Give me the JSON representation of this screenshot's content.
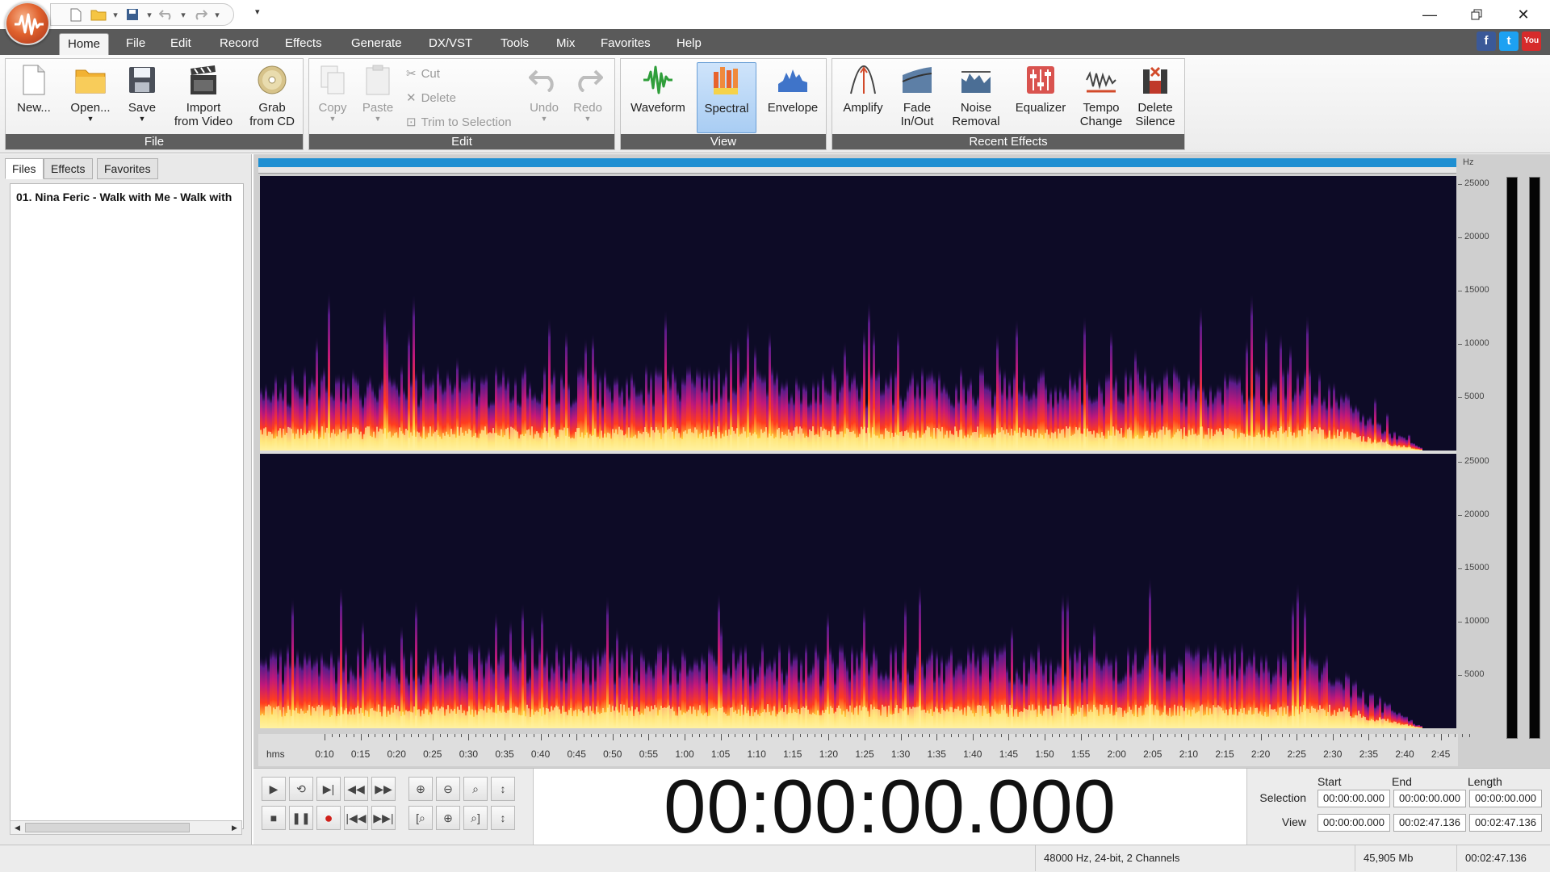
{
  "window": {
    "controls": [
      "minimize",
      "restore",
      "close"
    ]
  },
  "quick_access": [
    "new",
    "open",
    "save",
    "undo",
    "redo"
  ],
  "menu": {
    "tabs": [
      "Home",
      "File",
      "Edit",
      "Record",
      "Effects",
      "Generate",
      "DX/VST",
      "Tools",
      "Mix",
      "Favorites",
      "Help"
    ],
    "active": "Home"
  },
  "social": {
    "facebook": "f",
    "twitter": "t",
    "youtube": "You"
  },
  "ribbon": {
    "file": {
      "label": "File",
      "new": "New...",
      "open": "Open...",
      "save": "Save",
      "import_video_1": "Import",
      "import_video_2": "from Video",
      "grab_cd_1": "Grab",
      "grab_cd_2": "from CD"
    },
    "edit": {
      "label": "Edit",
      "copy": "Copy",
      "paste": "Paste",
      "cut": "Cut",
      "delete": "Delete",
      "trim": "Trim to Selection",
      "undo": "Undo",
      "redo": "Redo"
    },
    "view": {
      "label": "View",
      "waveform": "Waveform",
      "spectral": "Spectral",
      "envelope": "Envelope",
      "selected": "Spectral"
    },
    "recent": {
      "label": "Recent Effects",
      "amplify": "Amplify",
      "fade_1": "Fade",
      "fade_2": "In/Out",
      "noise_1": "Noise",
      "noise_2": "Removal",
      "equalizer": "Equalizer",
      "tempo_1": "Tempo",
      "tempo_2": "Change",
      "silence_1": "Delete",
      "silence_2": "Silence"
    }
  },
  "panel": {
    "tabs": [
      "Files",
      "Effects",
      "Favorites"
    ],
    "active": "Files",
    "files": [
      "01. Nina Feric - Walk with Me - Walk with"
    ]
  },
  "editor": {
    "freq_unit": "Hz",
    "freq_ticks": [
      "25000",
      "20000",
      "15000",
      "10000",
      "5000"
    ],
    "time_unit": "hms",
    "time_ticks": [
      "0:10",
      "0:15",
      "0:20",
      "0:25",
      "0:30",
      "0:35",
      "0:40",
      "0:45",
      "0:50",
      "0:55",
      "1:00",
      "1:05",
      "1:10",
      "1:15",
      "1:20",
      "1:25",
      "1:30",
      "1:35",
      "1:40",
      "1:45",
      "1:50",
      "1:55",
      "2:00",
      "2:05",
      "2:10",
      "2:15",
      "2:20",
      "2:25",
      "2:30",
      "2:35",
      "2:40",
      "2:45"
    ],
    "colors": {
      "background": "#0d0b26",
      "overview": "#1e8fd2"
    }
  },
  "transport": {
    "clock": "00:00:00.000",
    "headers": {
      "start": "Start",
      "end": "End",
      "length": "Length"
    },
    "selection": {
      "label": "Selection",
      "start": "00:00:00.000",
      "end": "00:00:00.000",
      "length": "00:00:00.000"
    },
    "view": {
      "label": "View",
      "start": "00:00:00.000",
      "end": "00:02:47.136",
      "length": "00:02:47.136"
    }
  },
  "status": {
    "format": "48000 Hz, 24-bit, 2 Channels",
    "size": "45,905 Mb",
    "duration": "00:02:47.136"
  }
}
